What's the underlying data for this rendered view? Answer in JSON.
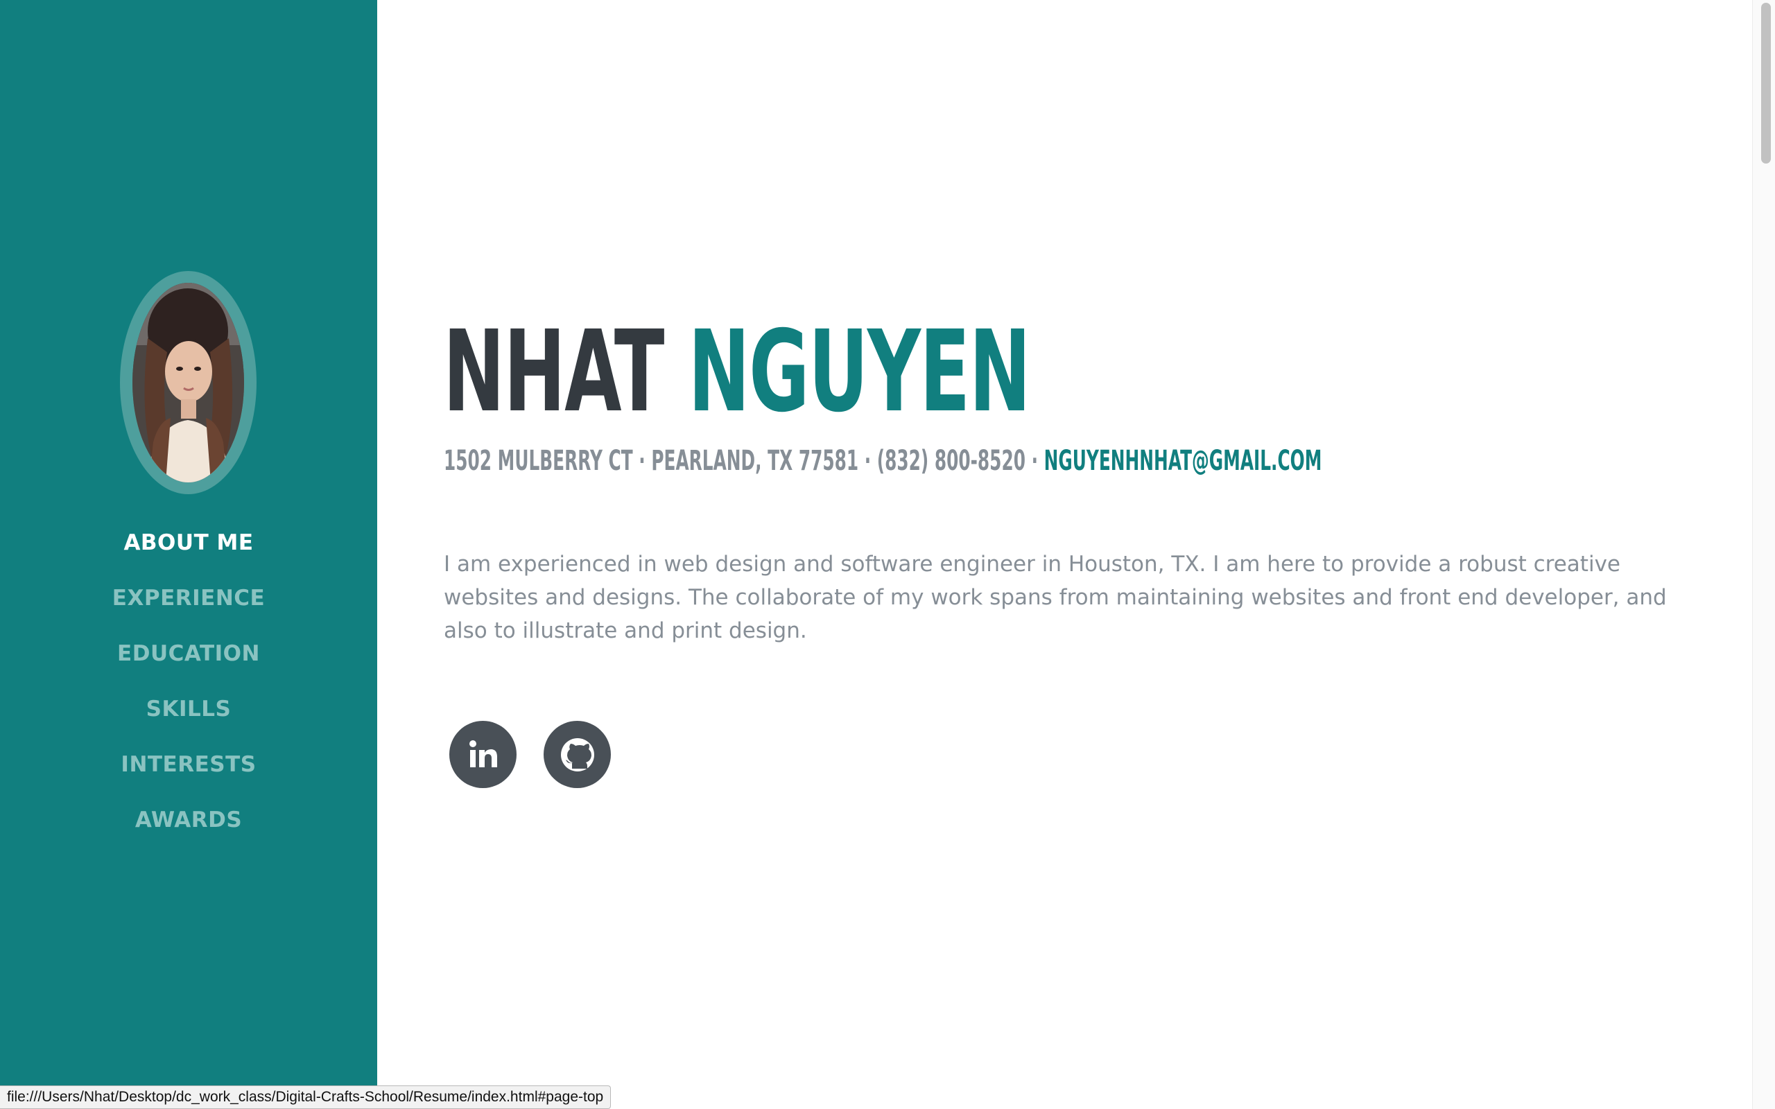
{
  "sidebar": {
    "avatar_alt": "profile photo",
    "nav_items": [
      {
        "label": "ABOUT ME",
        "active": true
      },
      {
        "label": "EXPERIENCE",
        "active": false
      },
      {
        "label": "EDUCATION",
        "active": false
      },
      {
        "label": "SKILLS",
        "active": false
      },
      {
        "label": "INTERESTS",
        "active": false
      },
      {
        "label": "AWARDS",
        "active": false
      }
    ]
  },
  "main": {
    "first_name": "NHAT",
    "last_name": "NGUYEN",
    "contact_address": "1502 MULBERRY CT · PEARLAND, TX 77581 · (832) 800-8520 · ",
    "contact_email": "NGUYENHNHAT@GMAIL.COM",
    "about_text": "I am experienced in web design and software engineer in Houston, TX. I am here to provide a robust creative websites and designs. The collaborate of my work spans from maintaining websites and front end developer, and also to illustrate and print design.",
    "social": [
      {
        "name": "linkedin",
        "icon": "linkedin-icon"
      },
      {
        "name": "github",
        "icon": "github-icon"
      }
    ]
  },
  "status_bar": {
    "url": "file:///Users/Nhat/Desktop/dc_work_class/Digital-Crafts-School/Resume/index.html#page-top"
  },
  "colors": {
    "primary": "#117f7f",
    "dark": "#343a40",
    "muted": "#868e96",
    "nav_inactive": "#8ac3c1"
  }
}
